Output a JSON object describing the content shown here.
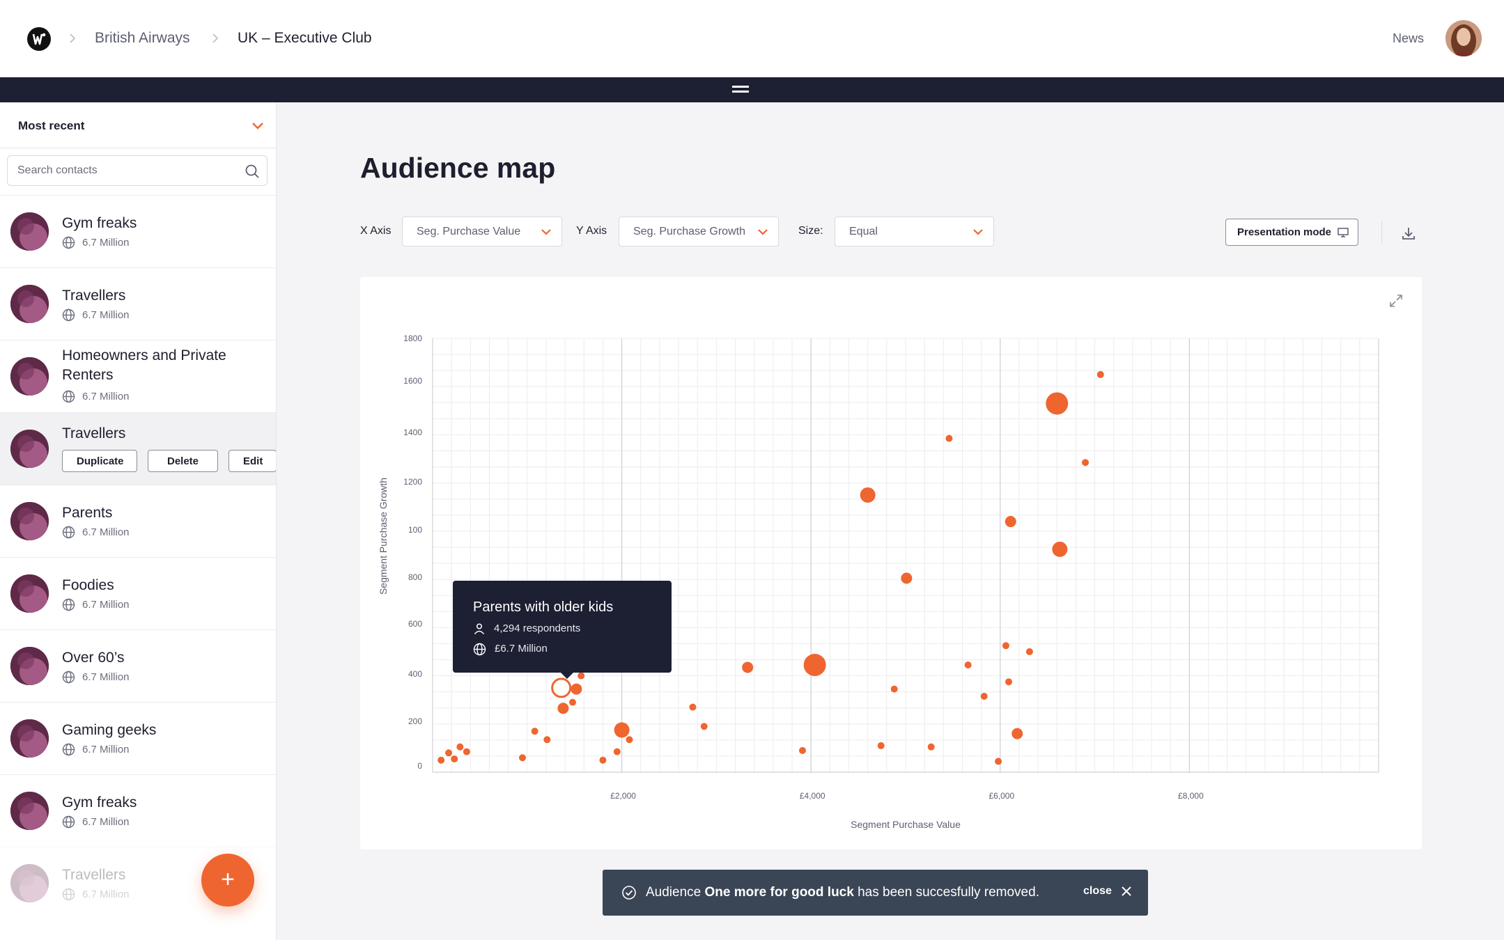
{
  "header": {
    "breadcrumb": [
      "British Airways",
      "UK – Executive Club"
    ],
    "news_label": "News"
  },
  "sidebar": {
    "sort_label": "Most recent",
    "search_placeholder": "Search contacts",
    "contacts": [
      {
        "name": "Gym freaks",
        "size": "6.7 Million"
      },
      {
        "name": "Travellers",
        "size": "6.7 Million"
      },
      {
        "name": "Homeowners and Private Renters",
        "size": "6.7 Million"
      },
      {
        "name": "Travellers",
        "size": "",
        "selected": true
      },
      {
        "name": "Parents",
        "size": "6.7 Million"
      },
      {
        "name": "Foodies",
        "size": "6.7 Million"
      },
      {
        "name": "Over 60’s",
        "size": "6.7 Million"
      },
      {
        "name": "Gaming geeks",
        "size": "6.7 Million"
      },
      {
        "name": "Gym freaks",
        "size": "6.7 Million"
      },
      {
        "name": "Travellers",
        "size": "6.7 Million"
      }
    ],
    "actions": {
      "duplicate": "Duplicate",
      "delete": "Delete",
      "edit": "Edit"
    },
    "fab_label": "+"
  },
  "main": {
    "title": "Audience map",
    "x_axis_label": "X Axis",
    "x_axis_value": "Seg. Purchase Value",
    "y_axis_label": "Y Axis",
    "y_axis_value": "Seg. Purchase Growth",
    "size_label": "Size:",
    "size_value": "Equal",
    "presentation_button": "Presentation mode"
  },
  "tooltip": {
    "title": "Parents with older kids",
    "respondents": "4,294 respondents",
    "value": "£6.7 Million"
  },
  "toast": {
    "prefix": "Audience",
    "audience_name": "One more for good luck",
    "suffix": "has been succesfully removed.",
    "close_label": "close"
  },
  "colors": {
    "accent": "#ef6530",
    "dark": "#1d1f32",
    "toast": "#3a4556",
    "avatar": "#5f2948"
  },
  "chart_data": {
    "type": "scatter",
    "xlabel": "Segment Purchase Value",
    "ylabel": "Segment Purchase Growth",
    "x_ticks": [
      "£2,000",
      "£4,000",
      "£6,000",
      "£8,000"
    ],
    "y_ticks": [
      "0",
      "200",
      "400",
      "600",
      "800",
      "100",
      "1200",
      "1400",
      "1600",
      "1800"
    ],
    "xlim": [
      0,
      10000
    ],
    "ylim": [
      0,
      1800
    ],
    "grid": true,
    "points": [
      {
        "x": 90,
        "y": 50,
        "size": "s"
      },
      {
        "x": 170,
        "y": 80,
        "size": "s"
      },
      {
        "x": 230,
        "y": 55,
        "size": "s"
      },
      {
        "x": 290,
        "y": 105,
        "size": "s"
      },
      {
        "x": 360,
        "y": 85,
        "size": "s"
      },
      {
        "x": 950,
        "y": 60,
        "size": "s"
      },
      {
        "x": 1080,
        "y": 170,
        "size": "s"
      },
      {
        "x": 1210,
        "y": 135,
        "size": "s"
      },
      {
        "x": 1360,
        "y": 350,
        "size": "m",
        "hollow": true
      },
      {
        "x": 1380,
        "y": 265,
        "size": "m"
      },
      {
        "x": 1480,
        "y": 290,
        "size": "s"
      },
      {
        "x": 1520,
        "y": 345,
        "size": "m"
      },
      {
        "x": 1570,
        "y": 400,
        "size": "s"
      },
      {
        "x": 1800,
        "y": 50,
        "size": "s"
      },
      {
        "x": 1950,
        "y": 85,
        "size": "s"
      },
      {
        "x": 2000,
        "y": 175,
        "size": "l"
      },
      {
        "x": 2080,
        "y": 135,
        "size": "s"
      },
      {
        "x": 2750,
        "y": 270,
        "size": "s"
      },
      {
        "x": 2870,
        "y": 190,
        "size": "s"
      },
      {
        "x": 3330,
        "y": 435,
        "size": "m"
      },
      {
        "x": 3910,
        "y": 90,
        "size": "s"
      },
      {
        "x": 4040,
        "y": 445,
        "size": "xl"
      },
      {
        "x": 4600,
        "y": 1150,
        "size": "l"
      },
      {
        "x": 4740,
        "y": 110,
        "size": "s"
      },
      {
        "x": 4880,
        "y": 345,
        "size": "s"
      },
      {
        "x": 5010,
        "y": 805,
        "size": "m"
      },
      {
        "x": 5270,
        "y": 105,
        "size": "s"
      },
      {
        "x": 5460,
        "y": 1385,
        "size": "s"
      },
      {
        "x": 5660,
        "y": 445,
        "size": "s"
      },
      {
        "x": 5830,
        "y": 315,
        "size": "s"
      },
      {
        "x": 5980,
        "y": 45,
        "size": "s"
      },
      {
        "x": 6060,
        "y": 525,
        "size": "s"
      },
      {
        "x": 6090,
        "y": 375,
        "size": "s"
      },
      {
        "x": 6110,
        "y": 1040,
        "size": "m"
      },
      {
        "x": 6180,
        "y": 160,
        "size": "m"
      },
      {
        "x": 6310,
        "y": 500,
        "size": "s"
      },
      {
        "x": 6600,
        "y": 1530,
        "size": "xl"
      },
      {
        "x": 6630,
        "y": 925,
        "size": "l"
      },
      {
        "x": 6900,
        "y": 1285,
        "size": "s"
      },
      {
        "x": 7060,
        "y": 1650,
        "size": "s"
      }
    ]
  }
}
